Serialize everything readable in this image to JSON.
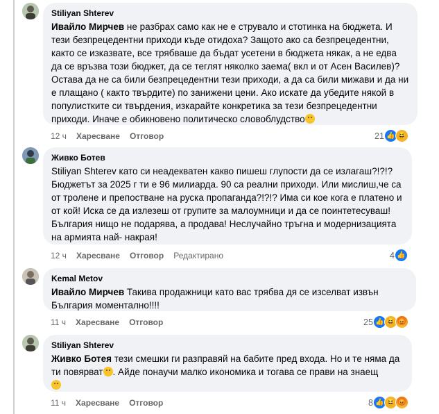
{
  "comments": [
    {
      "author": "Stiliyan Shterev",
      "mention": "Ивайло Мирчев",
      "text": " не разбрах само как не е струвало и стотинка на бюджета. И тези безпрецедентни приходи къде отидоха? Защото ако са безпрецедентни, както се изказвате, все трябваше да бъдат усетени в бюджета някак, а не едва да се връзва този бюджет, да се теглят няколко заема( вкл и от Асен Василев)? Остава да не са били безпрецедентни тези приходи, а да са били мижави и да ни е плащано ( както твърдите) по занижени цени. Ако искате да убедите някой в популистките си твърдения, изкарайте конкретика за тези безпрецедентни приходи. Иначе е обикновено политическо словоблудство",
      "time": "12 ч",
      "like_label": "Харесване",
      "reply_label": "Отговор",
      "edited_label": "",
      "reaction_count": "21",
      "reactions": [
        "like-icon",
        "haha-icon"
      ]
    },
    {
      "author": "Живко Ботев",
      "mention": "",
      "text": "Stiliyan Shterev като си неадекватен какво пишеш глупости да се излагаш?!?!? Бюджетът за 2025 г ти е 96 милиарда. 90 са реални приходи. Или мислиш,че са от тролене и препостване на руска пропаганда?!?!? Има си кое кога е платено и от кой! Иска се да излезеш от групите за малоумници и да се поинтетесуваш! България нищо не подарява, а продава! Неслучайно тръгна и модернизацията на армията най- накрая!",
      "time": "12 ч",
      "like_label": "Харесване",
      "reply_label": "Отговор",
      "edited_label": "Редактирано",
      "reaction_count": "4",
      "reactions": [
        "like-icon"
      ]
    },
    {
      "author": "Kemal Metov",
      "mention": "Ивайло Мирчев",
      "text": " Такива продажници като вас трябва дя се изселват извън България моментално!!!!",
      "time": "11 ч",
      "like_label": "Харесване",
      "reply_label": "Отговор",
      "edited_label": "",
      "reaction_count": "25",
      "reactions": [
        "like-icon",
        "haha-icon",
        "angry-icon"
      ]
    },
    {
      "author": "Stiliyan Shterev",
      "mention": "Живко Ботея",
      "text": " тези смешки ги разправяй на бабите пред входа. Но и те няма да ти повярват",
      "text2": ". Айде понаучи малко икономика и тогава се прави на знаещ",
      "time": "11 ч",
      "like_label": "Харесване",
      "reply_label": "Отговор",
      "edited_label": "",
      "reaction_count": "8",
      "reactions": [
        "like-icon",
        "haha-icon",
        "angry-icon"
      ]
    }
  ],
  "colors": {
    "bubble": "#f0f2f5",
    "like": "#1877f2",
    "haha": "#f7b125",
    "meta": "#65676b"
  }
}
